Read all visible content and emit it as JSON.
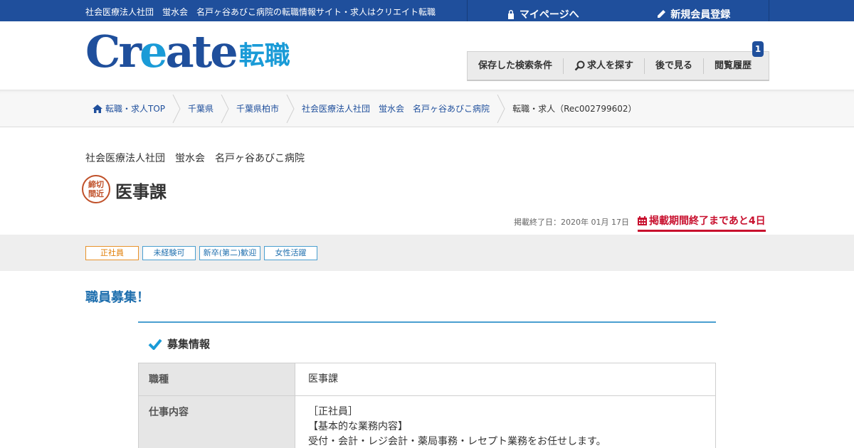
{
  "topbar": {
    "tagline": "社会医療法人社団　蛍水会　名戸ヶ谷あびこ病院の転職情報サイト・求人はクリエイト転職",
    "mypage_label": "マイページへ",
    "register_label": "新規会員登録"
  },
  "logo": {
    "en_pre": "Cr",
    "en_e": "e",
    "en_post": "ate",
    "ja": "転職"
  },
  "nav": {
    "saved_search": "保存した検索条件",
    "find_jobs": "求人を探す",
    "later": "後で見る",
    "history": "閲覧履歴",
    "history_count": "1"
  },
  "breadcrumb": {
    "home": "転職・求人TOP",
    "pref": "千葉県",
    "city": "千葉県柏市",
    "employer": "社会医療法人社団　蛍水会　名戸ヶ谷あびこ病院",
    "current": "転職・求人（Rec002799602）"
  },
  "job": {
    "hospital": "社会医療法人社団　蛍水会　名戸ヶ谷あびこ病院",
    "stamp_line1": "締切",
    "stamp_line2": "間近",
    "title": "医事課",
    "end_date": "掲載終了日：2020年 01月 17日",
    "remaining": "掲載期間終了まであと4日"
  },
  "tags": [
    "正社員",
    "未経験可",
    "新卒(第二)歓迎",
    "女性活躍"
  ],
  "recruit_heading": "職員募集！",
  "section_title": "募集情報",
  "info": {
    "occupation_label": "職種",
    "occupation_value": "医事課",
    "work_label": "仕事内容",
    "work_lines": [
      "［正社員］",
      "【基本的な業務内容】",
      "受付・会計・レジ会計・薬局事務・レセプト業務をお任せします。"
    ]
  },
  "colors": {
    "brand_blue": "#1f4f9c",
    "accent_blue": "#1a9bd7",
    "alert_red": "#c8102e",
    "tag_orange": "#e8922a"
  },
  "icons": [
    "lock-icon",
    "pencil-icon",
    "search-icon",
    "home-icon",
    "calendar-icon",
    "check-icon"
  ]
}
